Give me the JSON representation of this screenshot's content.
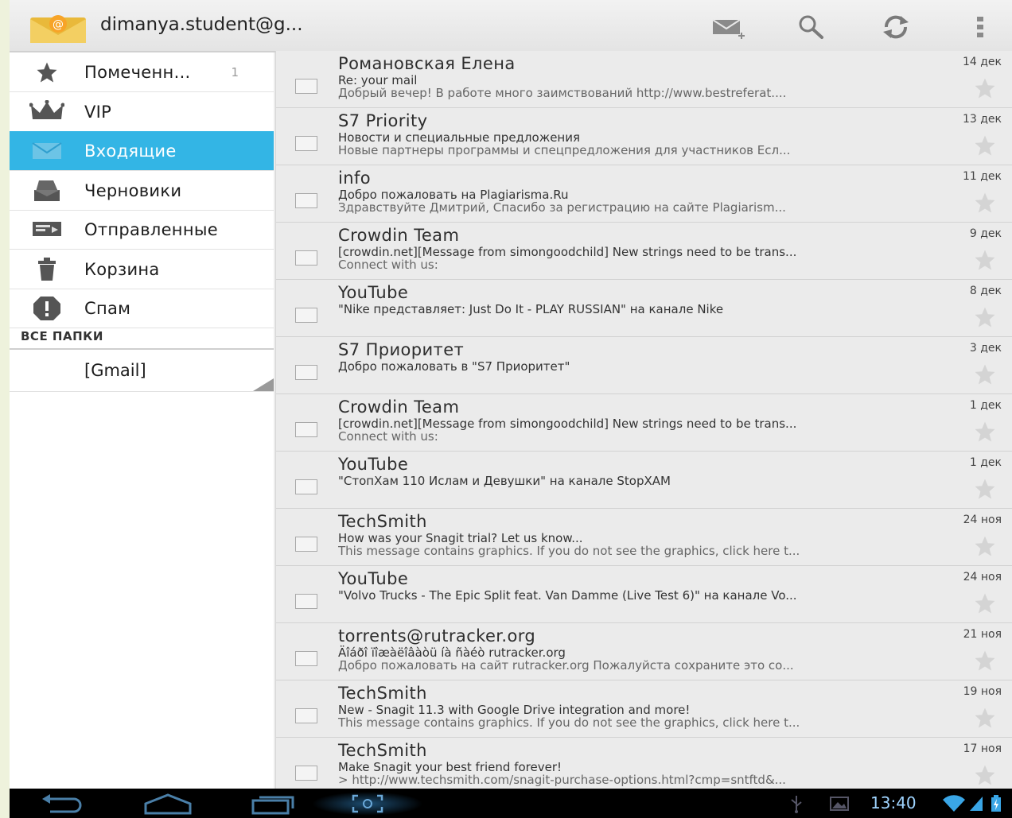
{
  "header": {
    "account": "dimanya.student@g...",
    "actions": [
      {
        "name": "compose-icon"
      },
      {
        "name": "search-icon"
      },
      {
        "name": "refresh-icon"
      },
      {
        "name": "overflow-menu-icon"
      }
    ]
  },
  "drawer": {
    "items": [
      {
        "icon": "star-icon",
        "label": "Помеченн...",
        "count": "1"
      },
      {
        "icon": "crown-icon",
        "label": "VIP",
        "count": ""
      },
      {
        "icon": "inbox-icon",
        "label": "Входящие",
        "count": "",
        "selected": true
      },
      {
        "icon": "drafts-icon",
        "label": "Черновики",
        "count": ""
      },
      {
        "icon": "sent-icon",
        "label": "Отправленные",
        "count": ""
      },
      {
        "icon": "trash-icon",
        "label": "Корзина",
        "count": ""
      },
      {
        "icon": "spam-icon",
        "label": "Спам",
        "count": ""
      }
    ],
    "section_header": "ВСЕ ПАПКИ",
    "gmail_label": "[Gmail]"
  },
  "messages": [
    {
      "sender": "Романовская Елена",
      "subject": "Re: your mail",
      "snippet": "Добрый вечер! В работе много заимствований http://www.bestreferat....",
      "date": "14 дек"
    },
    {
      "sender": "S7 Priority",
      "subject": "Новости и специальные предложения",
      "snippet": "Новые партнеры программы и спецпредложения для участников Есл...",
      "date": "13 дек"
    },
    {
      "sender": "info",
      "subject": "Добро пожаловать на Plagiarisma.Ru",
      "snippet": "Здравствуйте Дмитрий, Спасибо за регистрацию на сайте Plagiarism...",
      "date": "11 дек"
    },
    {
      "sender": "Crowdin Team",
      "subject": "[crowdin.net][Message from simongoodchild] New strings need to be trans...",
      "snippet": "Connect with us:",
      "date": "9 дек"
    },
    {
      "sender": "YouTube",
      "subject": "\"Nike представляет: Just Do It - PLAY RUSSIAN\" на канале Nike",
      "snippet": "",
      "date": "8 дек"
    },
    {
      "sender": "S7 Приоритет",
      "subject": "Добро пожаловать в \"S7 Приоритет\"",
      "snippet": "",
      "date": "3 дек"
    },
    {
      "sender": "Crowdin Team",
      "subject": "[crowdin.net][Message from simongoodchild] New strings need to be trans...",
      "snippet": "Connect with us:",
      "date": "1 дек"
    },
    {
      "sender": "YouTube",
      "subject": "\"СтопХам 110 Ислам и Девушки\" на канале StopXAM",
      "snippet": "",
      "date": "1 дек"
    },
    {
      "sender": "TechSmith",
      "subject": "How was your Snagit trial? Let us know...",
      "snippet": "This message contains graphics. If you do not see the graphics, click here t...",
      "date": "24 ноя"
    },
    {
      "sender": "YouTube",
      "subject": "\"Volvo Trucks - The Epic Split feat. Van Damme (Live Test 6)\" на канале Vo...",
      "snippet": "",
      "date": "24 ноя"
    },
    {
      "sender": "torrents@rutracker.org",
      "subject": "Äîáðî ïîæàëîâàòü íà ñàéò rutracker.org",
      "snippet": "Добро пожаловать на сайт rutracker.org Пожалуйста сохраните это со...",
      "date": "21 ноя"
    },
    {
      "sender": "TechSmith",
      "subject": "New - Snagit 11.3 with Google Drive integration and more!",
      "snippet": "This message contains graphics. If you do not see the graphics, click here t...",
      "date": "19 ноя"
    },
    {
      "sender": "TechSmith",
      "subject": "Make Snagit your best friend forever!",
      "snippet": "> http://www.techsmith.com/snagit-purchase-options.html?cmp=sntftd&...",
      "date": "17 ноя"
    }
  ],
  "system_bar": {
    "time": "13:40",
    "buttons": [
      "back-icon",
      "home-icon",
      "recent-apps-icon",
      "screenshot-icon"
    ],
    "status_icons": [
      "usb-icon",
      "gallery-icon",
      "wifi-icon",
      "signal-icon",
      "battery-icon"
    ]
  },
  "colors": {
    "accent": "#33b5e5",
    "list_bg": "#ebebeb",
    "drawer_bg": "#ffffff",
    "system_bar": "#000000"
  }
}
